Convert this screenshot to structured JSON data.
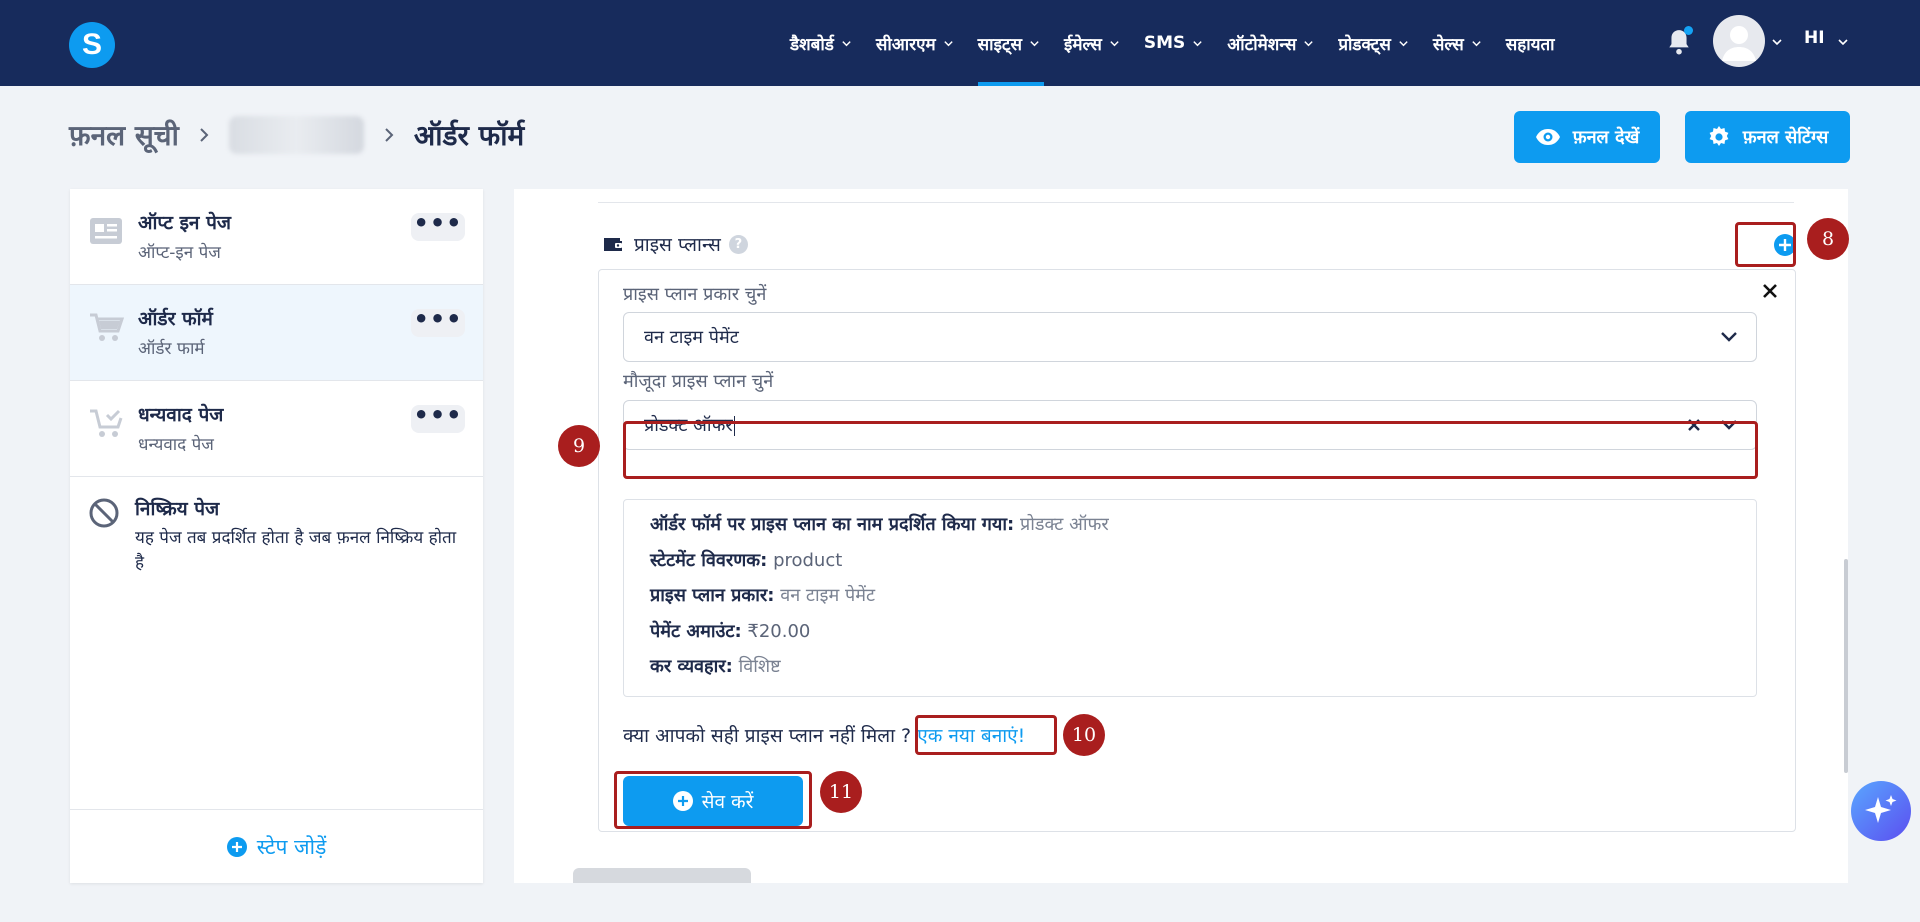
{
  "nav": {
    "logo_letter": "S",
    "items": [
      {
        "label": "डैशबोर्ड",
        "chevron": true
      },
      {
        "label": "सीआरएम",
        "chevron": true
      },
      {
        "label": "साइट्स",
        "chevron": true,
        "active": true
      },
      {
        "label": "ईमेल्स",
        "chevron": true
      },
      {
        "label": "SMS",
        "chevron": true
      },
      {
        "label": "ऑटोमेशन्स",
        "chevron": true
      },
      {
        "label": "प्रोडक्ट्स",
        "chevron": true
      },
      {
        "label": "सेल्स",
        "chevron": true
      },
      {
        "label": "सहायता",
        "chevron": false
      }
    ],
    "lang": "HI"
  },
  "breadcrumb": {
    "root": "फ़नल सूची",
    "current": "ऑर्डर फॉर्म"
  },
  "header_buttons": {
    "view_funnel": "फ़नल देखें",
    "funnel_settings": "फ़नल सेटिंग्स"
  },
  "sidebar": {
    "steps": [
      {
        "title": "ऑप्ट इन पेज",
        "sub": "ऑप्ट-इन पेज",
        "menu": "•••"
      },
      {
        "title": "ऑर्डर फॉर्म",
        "sub": "ऑर्डर फार्म",
        "menu": "•••"
      },
      {
        "title": "धन्यवाद पेज",
        "sub": "धन्यवाद पेज",
        "menu": "•••"
      }
    ],
    "inactive": {
      "title": "निष्क्रिय पेज",
      "desc": "यह पेज तब प्रदर्शित होता है जब फ़नल निष्क्रिय होता है"
    },
    "add_step": "स्टेप जोड़ें"
  },
  "price_plans": {
    "section_title": "प्राइस प्लान्स",
    "help": "?",
    "type_label": "प्राइस प्लान प्रकार चुनें",
    "type_value": "वन टाइम पेमेंट",
    "existing_label": "मौजूदा प्राइस प्लान चुनें",
    "existing_value": "प्रोडक्ट ऑफर",
    "info": [
      {
        "k": "ऑर्डर फॉर्म पर प्राइस प्लान का नाम प्रदर्शित किया गया:",
        "v": "प्रोडक्ट ऑफर"
      },
      {
        "k": "स्टेटमेंट विवरणक:",
        "v": "product"
      },
      {
        "k": "प्राइस प्लान प्रकार:",
        "v": "वन टाइम पेमेंट"
      },
      {
        "k": "पेमेंट अमाउंट:",
        "v": "₹20.00"
      },
      {
        "k": "कर व्यवहार:",
        "v": "विशिष्ट"
      }
    ],
    "question": "क्या आपको सही प्राइस प्लान नहीं मिला ?",
    "create_link": "एक नया बनाएं!",
    "save": "सेव करें"
  },
  "annotations": [
    "8",
    "9",
    "10",
    "11"
  ],
  "colors": {
    "nav_bg": "#172b5c",
    "accent": "#0d9bf0",
    "annotation": "#a91e1e"
  }
}
